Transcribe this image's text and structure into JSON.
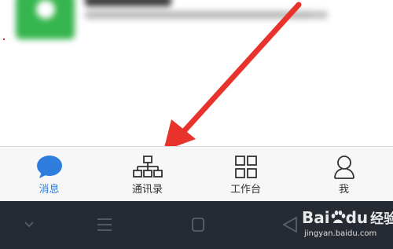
{
  "tabs": [
    {
      "label": "消息",
      "icon": "chat-bubble-icon",
      "active": true
    },
    {
      "label": "通讯录",
      "icon": "org-chart-icon",
      "active": false
    },
    {
      "label": "工作台",
      "icon": "grid-icon",
      "active": false
    },
    {
      "label": "我",
      "icon": "person-icon",
      "active": false
    }
  ],
  "navigation_bar": {
    "buttons": [
      "chevron-down-icon",
      "menu-lines-icon",
      "home-square-icon",
      "back-triangle-icon"
    ]
  },
  "watermark": {
    "logo_text": "Bai",
    "logo_text_2": "du",
    "logo_suffix": "经验",
    "url": "jingyan.baidu.com"
  },
  "colors": {
    "active_tab": "#2f7ede",
    "inactive_tab": "#333333",
    "arrow": "#e8322c",
    "tabbar_background": "#f7f7f7",
    "navbar_background": "#262a33",
    "avatar_green": "#35b54d"
  }
}
